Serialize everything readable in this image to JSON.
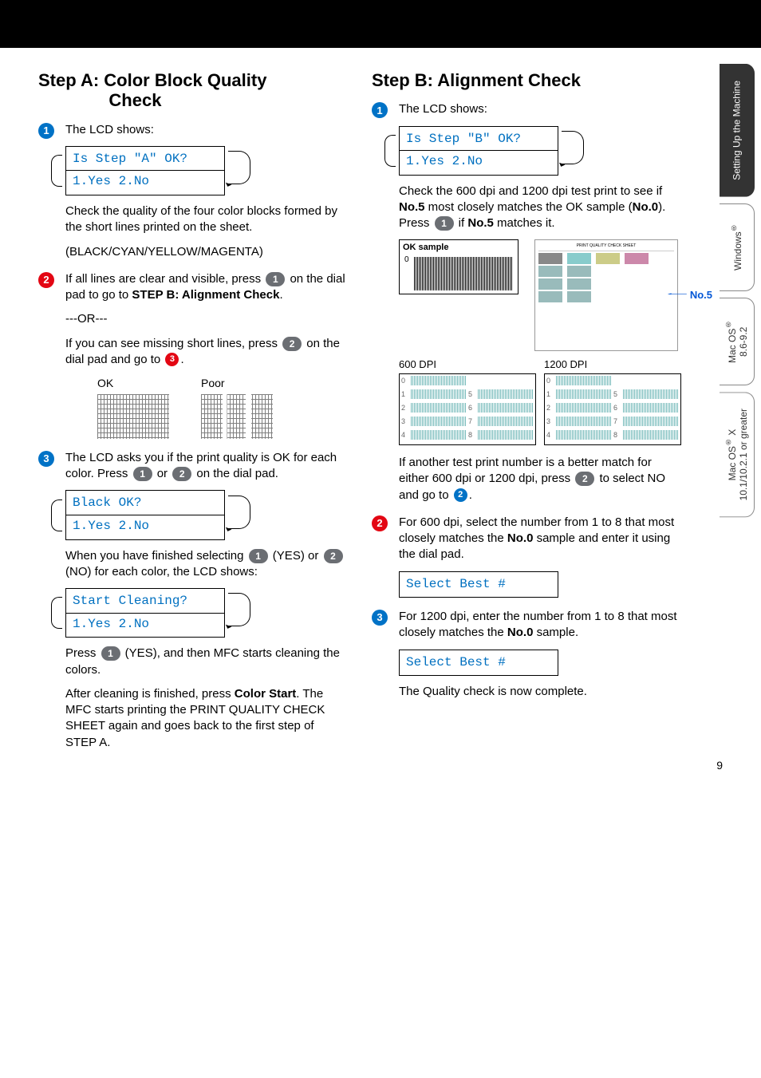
{
  "page_number": "9",
  "stepA": {
    "title_line1": "Step A:  Color Block Quality",
    "title_line2": "Check",
    "s1_intro": "The LCD shows:",
    "lcd1_l1": "Is Step \"A\" OK?",
    "lcd1_l2": "1.Yes 2.No",
    "s1_p1": "Check the quality of the four color blocks formed by the short lines printed on the sheet.",
    "s1_p2": "(BLACK/CYAN/YELLOW/MAGENTA)",
    "s2_a": "If all lines are clear and visible, press ",
    "s2_b": " on the dial pad to go to ",
    "s2_bold": "STEP B: Alignment Check",
    "s2_c": ".",
    "or": "---OR---",
    "s2_d": "If you can see missing short lines, press ",
    "s2_e": " on the dial pad and go to ",
    "s2_f": ".",
    "ok_label": "OK",
    "poor_label": "Poor",
    "s3_a": "The LCD asks you if the print quality is OK for each color. Press ",
    "s3_b": " or ",
    "s3_c": " on the dial pad.",
    "lcd2_l1": "Black OK?",
    "lcd2_l2": "1.Yes 2.No",
    "s3_d": "When you have finished selecting ",
    "s3_e": " (YES) or ",
    "s3_f": " (NO) for each color, the LCD shows:",
    "lcd3_l1": "Start Cleaning?",
    "lcd3_l2": "1.Yes 2.No",
    "s3_g": "Press ",
    "s3_h": " (YES), and then MFC starts cleaning the colors.",
    "s3_i": "After cleaning is finished, press ",
    "s3_bold2": "Color Start",
    "s3_j": ". The MFC starts printing the PRINT QUALITY CHECK SHEET again and goes back to the first step of STEP A."
  },
  "stepB": {
    "title": "Step B:  Alignment Check",
    "s1_intro": "The LCD shows:",
    "lcd1_l1": "Is Step \"B\" OK?",
    "lcd1_l2": "1.Yes 2.No",
    "s1_a": "Check the 600 dpi and 1200 dpi test print to see if ",
    "s1_bold1": "No.5",
    "s1_b": " most closely matches the OK sample (",
    "s1_bold2": "No.0",
    "s1_c": "). Press ",
    "s1_d": " if ",
    "s1_bold3": "No.5",
    "s1_e": " matches it.",
    "ok_sample": "OK sample",
    "zero": "0",
    "no5": "No.5",
    "dpi600": "600 DPI",
    "dpi1200": "1200 DPI",
    "dpi_nums_left": [
      "0",
      "1",
      "2",
      "3",
      "4"
    ],
    "dpi_nums_right": [
      "5",
      "6",
      "7",
      "8",
      " "
    ],
    "s1_f": "If another test print number is a better match for either 600 dpi or 1200 dpi, press ",
    "s1_g": " to select NO and go to ",
    "s1_h": ".",
    "s2_a": "For 600 dpi, select the number from 1 to 8 that most closely matches the ",
    "s2_bold": "No.0",
    "s2_b": " sample and enter it using the dial pad.",
    "lcd2": "Select Best #",
    "s3_a": "For 1200 dpi, enter the number from 1 to 8 that most closely matches the ",
    "s3_bold": "No.0",
    "s3_b": " sample.",
    "lcd3": "Select Best #",
    "final": "The Quality check is now complete."
  },
  "tabs": {
    "t1": "Setting Up the Machine",
    "t2": "Windows",
    "t3a": "Mac OS",
    "t3b": "8.6-9.2",
    "t4a": "Mac OS",
    "t4b": " X",
    "t4c": "10.1/10.2.1 or greater"
  },
  "keys": {
    "k1": "1",
    "k2": "2",
    "d3": "3",
    "d2": "2"
  }
}
